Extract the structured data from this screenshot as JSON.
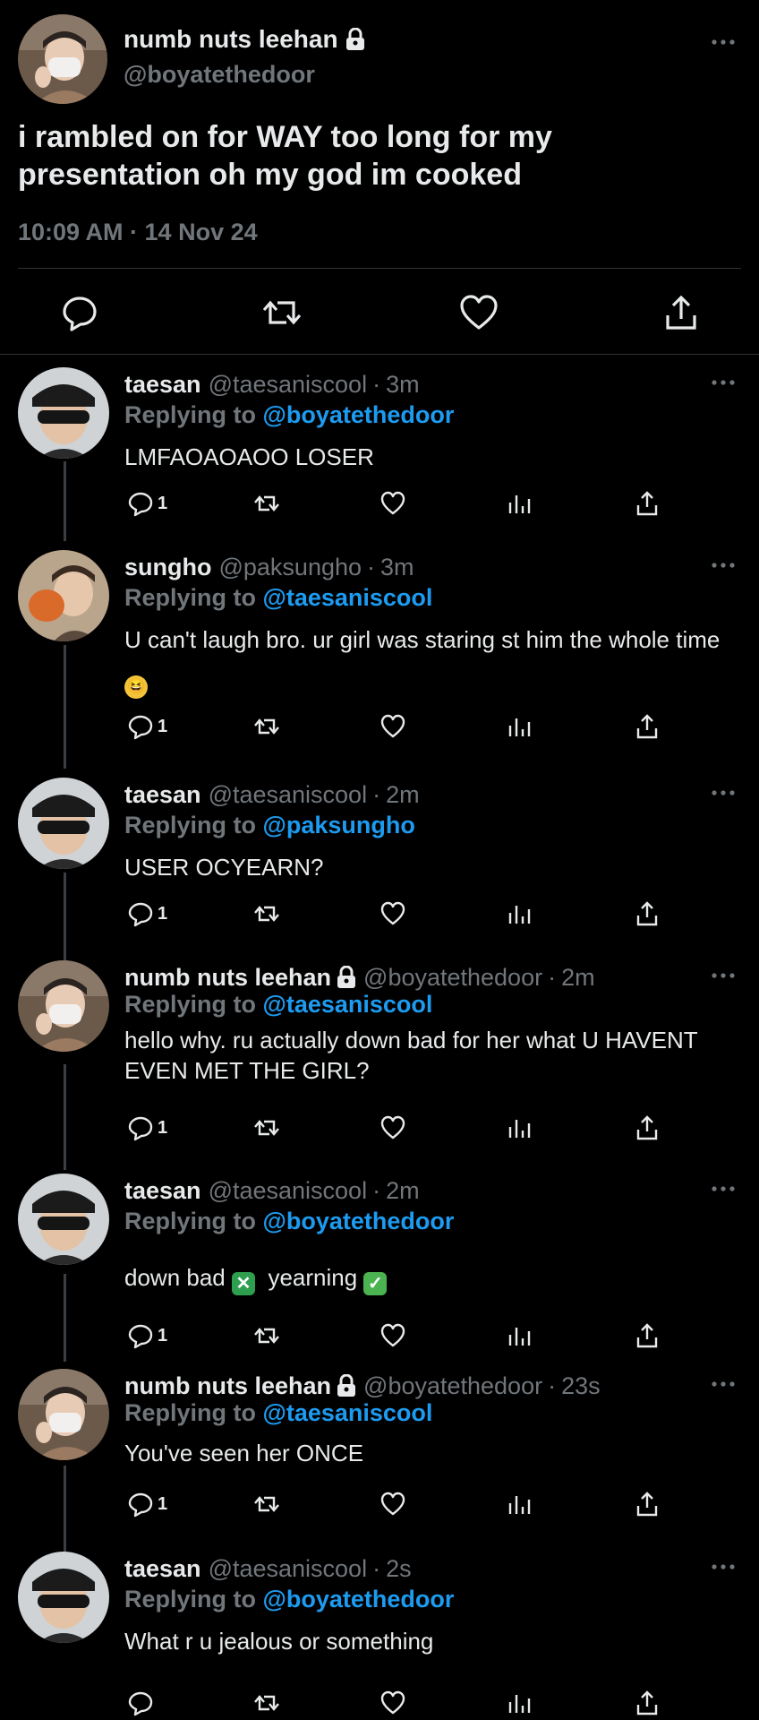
{
  "main_tweet": {
    "name": "numb nuts leehan",
    "handle": "@boyatethedoor",
    "text": "i rambled on for WAY too long for my presentation oh my god im cooked",
    "timestamp": "10:09 AM · 14 Nov 24",
    "actions": [
      "reply-icon",
      "retweet-icon",
      "like-icon",
      "share-icon"
    ]
  },
  "replies": [
    {
      "name": "taesan",
      "handle": "@taesaniscool",
      "time": "3m",
      "replying_prefix": "Replying to ",
      "replying_to": "@boyatethedoor",
      "text": "LMFAOAOAOO LOSER",
      "reply_count": "1",
      "avatar": "taesan"
    },
    {
      "name": "sungho",
      "handle": "@paksungho",
      "time": "3m",
      "replying_prefix": "Replying to ",
      "replying_to": "@taesaniscool",
      "text": "U can't laugh bro. ur girl was staring st him the whole time",
      "emoji": "😆",
      "reply_count": "1",
      "avatar": "sungho"
    },
    {
      "name": "taesan",
      "handle": "@taesaniscool",
      "time": "2m",
      "replying_prefix": "Replying to ",
      "replying_to": "@paksungho",
      "text": "USER OCYEARN?",
      "reply_count": "1",
      "avatar": "taesan"
    },
    {
      "name": "numb nuts leehan",
      "handle": "@boyatethedoor",
      "time": "2m",
      "replying_prefix": "Replying to ",
      "replying_to": "@taesaniscool",
      "text": "hello why. ru actually down bad for her what U HAVENT EVEN MET THE GIRL?",
      "reply_count": "1",
      "avatar": "leehan",
      "locked": true
    },
    {
      "name": "taesan",
      "handle": "@taesaniscool",
      "time": "2m",
      "replying_prefix": "Replying to ",
      "replying_to": "@boyatethedoor",
      "text_a": "down bad",
      "text_b": "yearning",
      "emoji_a": "✕",
      "emoji_b": "✓",
      "reply_count": "1",
      "avatar": "taesan"
    },
    {
      "name": "numb nuts leehan",
      "handle": "@boyatethedoor",
      "time": "23s",
      "replying_prefix": "Replying to ",
      "replying_to": "@taesaniscool",
      "text": "You've seen her ONCE",
      "reply_count": "1",
      "avatar": "leehan",
      "locked": true
    },
    {
      "name": "taesan",
      "handle": "@taesaniscool",
      "time": "2s",
      "replying_prefix": "Replying to ",
      "replying_to": "@boyatethedoor",
      "text": "What r u jealous or something",
      "reply_count": "",
      "avatar": "taesan"
    }
  ],
  "separator": "·",
  "colors": {
    "background": "#000000",
    "text": "#e7e9ea",
    "muted": "#71767b",
    "link": "#1d9bf0",
    "divider": "#2f3336"
  }
}
